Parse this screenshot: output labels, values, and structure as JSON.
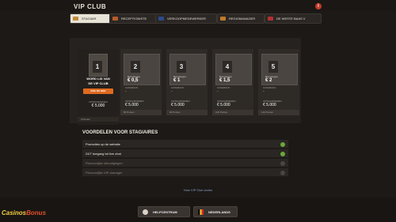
{
  "header": {
    "title": "VIP CLUB"
  },
  "tabs": [
    {
      "label": "STAGIAIR",
      "active": true,
      "color": "#c08a3a"
    },
    {
      "label": "RECEPTIONISTE",
      "color": "#b45b2a"
    },
    {
      "label": "VERKOOPMEDEWERKER",
      "color": "#2d4a8a"
    },
    {
      "label": "REGIOMANAGER",
      "color": "#c07a2a"
    },
    {
      "label": "DE WESTE BAAS V",
      "color": "#b03030"
    }
  ],
  "first_card": {
    "number": "1",
    "line1": "WORD LID VAN",
    "line2": "DE VIP CLUB",
    "button": "DOE NU MEE",
    "spend_label": "OPWAARDEREN",
    "spend_value": "€ 5.000",
    "points": "0 Punten"
  },
  "levels": [
    {
      "number": "2",
      "bonus_label": "Bonustegoe",
      "bonus_value": "€ 0,5",
      "cash_label": "CASHBACK",
      "cash_value": "-",
      "spend_label": "OPWAARDEREN",
      "spend_value": "€ 5.000",
      "points": "80 Punten"
    },
    {
      "number": "3",
      "bonus_label": "Bonustegoe",
      "bonus_value": "€ 1",
      "cash_label": "CASHBACK",
      "cash_value": "-",
      "spend_label": "OPWAARDEREN",
      "spend_value": "€ 5.000",
      "points": "90 Punten"
    },
    {
      "number": "4",
      "bonus_label": "Bonustegoe",
      "bonus_value": "€ 1,5",
      "cash_label": "CASHBACK",
      "cash_value": "-",
      "spend_label": "OPWAARDEREN",
      "spend_value": "€ 5.000",
      "points": "100 Punten"
    },
    {
      "number": "5",
      "bonus_label": "Bonustegoe",
      "bonus_value": "€ 2",
      "cash_label": "CASHBACK",
      "cash_value": "-",
      "spend_label": "OPWAARDEREN",
      "spend_value": "€ 5.000",
      "points": "110 Punten"
    }
  ],
  "benefits": {
    "title": "VOORDELEN VOOR STAGIAIRES",
    "items": [
      {
        "label": "Promoties op de website",
        "enabled": true
      },
      {
        "label": "24/7 toegang tot live chat",
        "enabled": true
      },
      {
        "label": "Persoonlijke uitnodigingen",
        "enabled": false
      },
      {
        "label": "Persoonlijke VIP-manager",
        "enabled": false
      }
    ]
  },
  "link": "How VIP Club works",
  "footer": {
    "help": "HELPCENTRUM",
    "language": "NEDERLANDS"
  },
  "logo": {
    "part1": "Casinos",
    "part2": "Bonus"
  }
}
